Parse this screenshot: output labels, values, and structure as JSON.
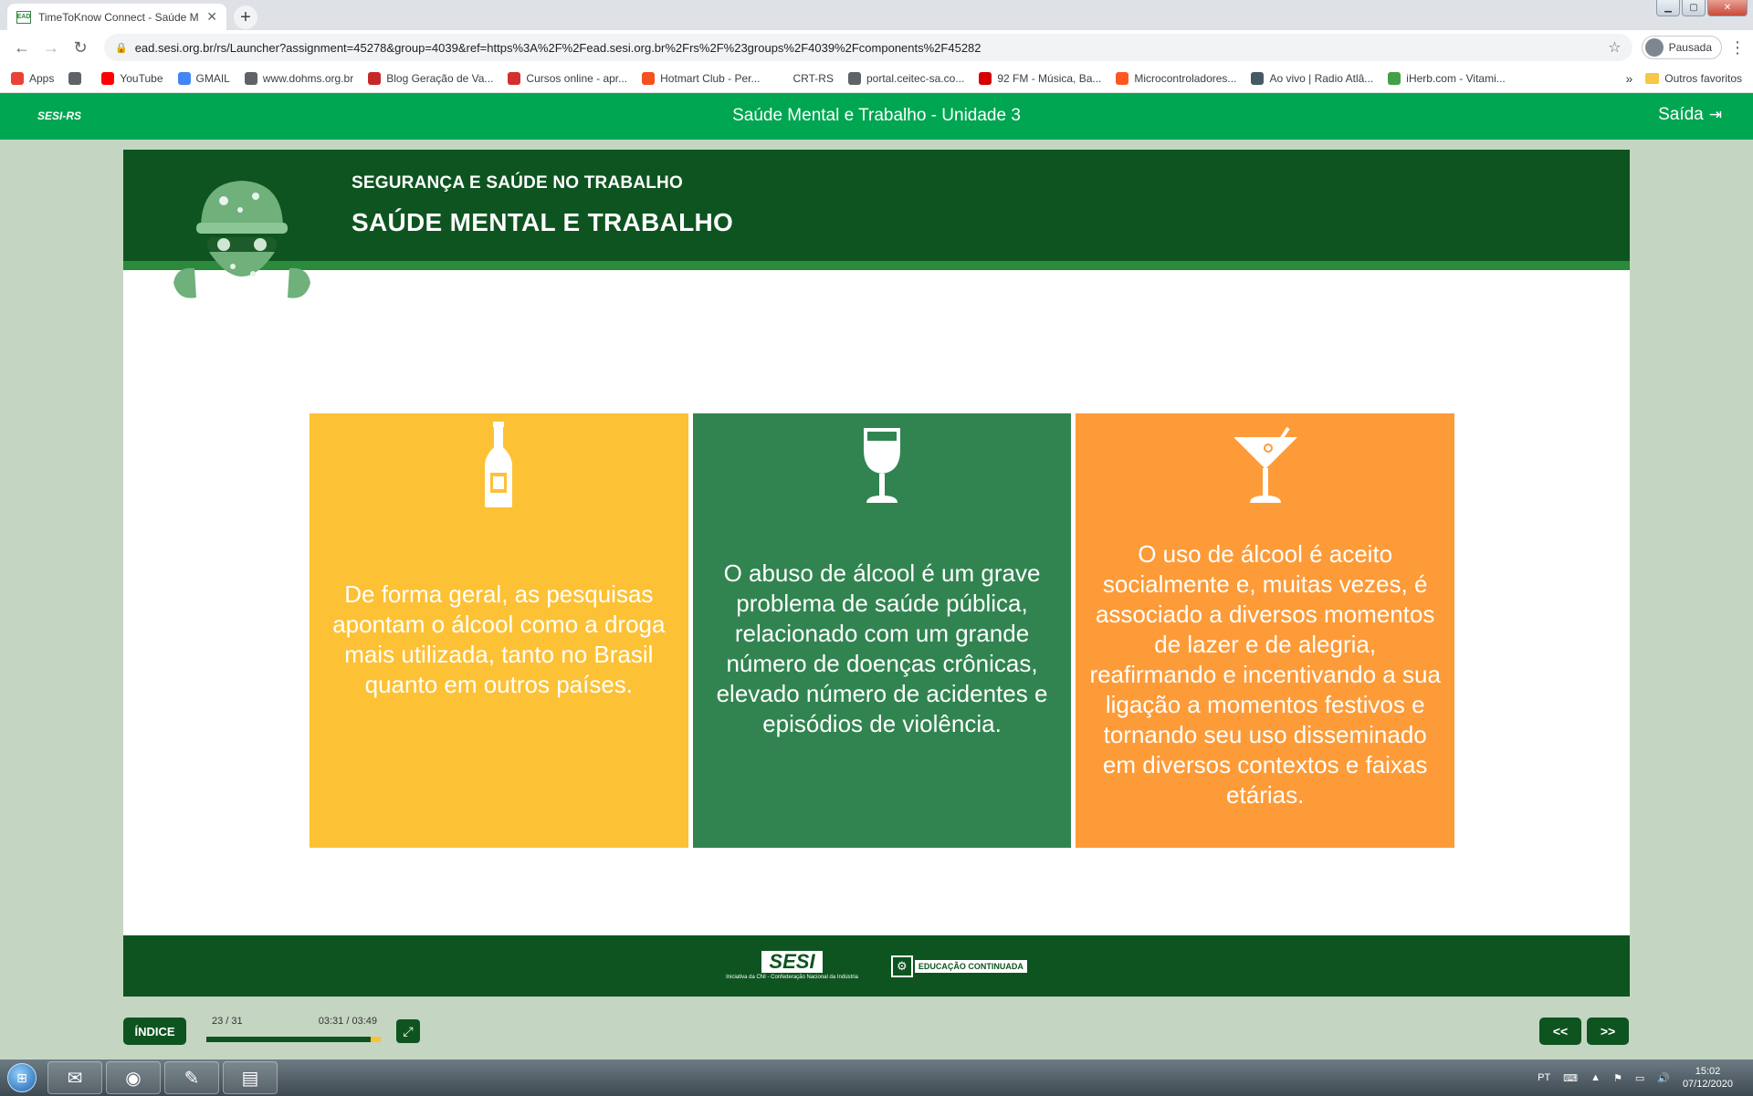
{
  "browser": {
    "tab_title": "TimeToKnow Connect - Saúde M",
    "tab_favicon": "EAD",
    "url": "ead.sesi.org.br/rs/Launcher?assignment=45278&group=4039&ref=https%3A%2F%2Fead.sesi.org.br%2Frs%2F%23groups%2F4039%2Fcomponents%2F45282",
    "profile_label": "Pausada",
    "bookmarks": [
      {
        "label": "Apps",
        "color": "#ea4335"
      },
      {
        "label": "",
        "color": "#5f6368"
      },
      {
        "label": "YouTube",
        "color": "#ff0000"
      },
      {
        "label": "GMAIL",
        "color": "#4285f4"
      },
      {
        "label": "www.dohms.org.br",
        "color": "#5f6368"
      },
      {
        "label": "Blog Geração de Va...",
        "color": "#c62828"
      },
      {
        "label": "Cursos online - apr...",
        "color": "#d32f2f"
      },
      {
        "label": "Hotmart Club - Per...",
        "color": "#f4511e"
      },
      {
        "label": "CRT-RS",
        "color": "#ffffff"
      },
      {
        "label": "portal.ceitec-sa.co...",
        "color": "#5f6368"
      },
      {
        "label": "92 FM - Música, Ba...",
        "color": "#d50000"
      },
      {
        "label": "Microcontroladores...",
        "color": "#ff5722"
      },
      {
        "label": "Ao vivo | Radio Atlâ...",
        "color": "#455a64"
      },
      {
        "label": "iHerb.com - Vitami...",
        "color": "#43a047"
      }
    ],
    "bookmarks_more": "»",
    "other_bookmarks": "Outros favoritos"
  },
  "app": {
    "logo": "SESI-RS",
    "title": "Saúde Mental e Trabalho - Unidade 3",
    "exit_label": "Saída"
  },
  "course": {
    "kicker": "SEGURANÇA E SAÚDE NO TRABALHO",
    "title": "SAÚDE MENTAL E TRABALHO"
  },
  "cards": [
    {
      "icon": "bottle-icon",
      "color": "#fdc136",
      "text": "De forma geral, as pesquisas apontam o álcool como a droga mais utilizada, tanto no Brasil quanto em outros países."
    },
    {
      "icon": "wine-glass-icon",
      "color": "#318450",
      "text": "O abuso de álcool é um grave problema de saúde pública, relacionado com um grande número de doenças crônicas, elevado número de acidentes e episódios de violência."
    },
    {
      "icon": "cocktail-icon",
      "color": "#fd9b38",
      "text": "O uso de álcool é aceito socialmente e, muitas vezes, é associado a diversos momentos de lazer e de alegria, reafirmando e incentivando a sua ligação a momentos festivos e tornando seu uso disseminado em diversos contextos e faixas etárias."
    }
  ],
  "footer": {
    "sesi_logo": "SESI",
    "sesi_tagline": "Iniciativa da CNI - Confederação Nacional da Indústria",
    "edu_logo": "EDUCAÇÃO CONTINUADA"
  },
  "player": {
    "index_label": "ÍNDICE",
    "pages": "23 / 31",
    "time": "03:31 / 03:49",
    "progress_fraction": 0.94,
    "prev_label": "<<",
    "next_label": ">>"
  },
  "taskbar": {
    "lang": "PT",
    "time": "15:02",
    "date": "07/12/2020"
  }
}
